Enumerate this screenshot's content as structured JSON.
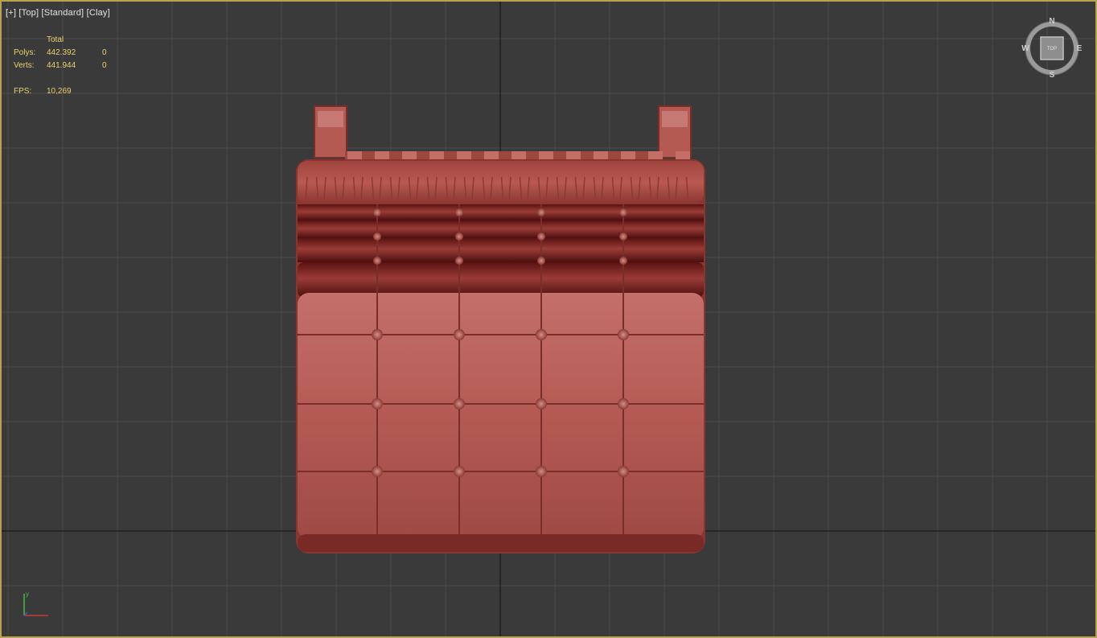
{
  "viewport": {
    "labels": {
      "plus": "[+]",
      "view": "[Top]",
      "shading": "[Standard]",
      "style": "[Clay]"
    },
    "stats": {
      "header": "Total",
      "polys_label": "Polys:",
      "polys_total": "442.392",
      "polys_sel": "0",
      "verts_label": "Verts:",
      "verts_total": "441.944",
      "verts_sel": "0",
      "fps_label": "FPS:",
      "fps_value": "10,269"
    },
    "viewcube": {
      "north": "N",
      "south": "S",
      "east": "E",
      "west": "W",
      "face": "TOP"
    },
    "axis": {
      "y": "y"
    },
    "colors": {
      "background": "#3a3a3a",
      "grid": "#4a4a4a",
      "home_grid": "#111111",
      "border": "#b8a24a",
      "stats_text": "#e8d26c",
      "clay": "#b85a52"
    }
  }
}
